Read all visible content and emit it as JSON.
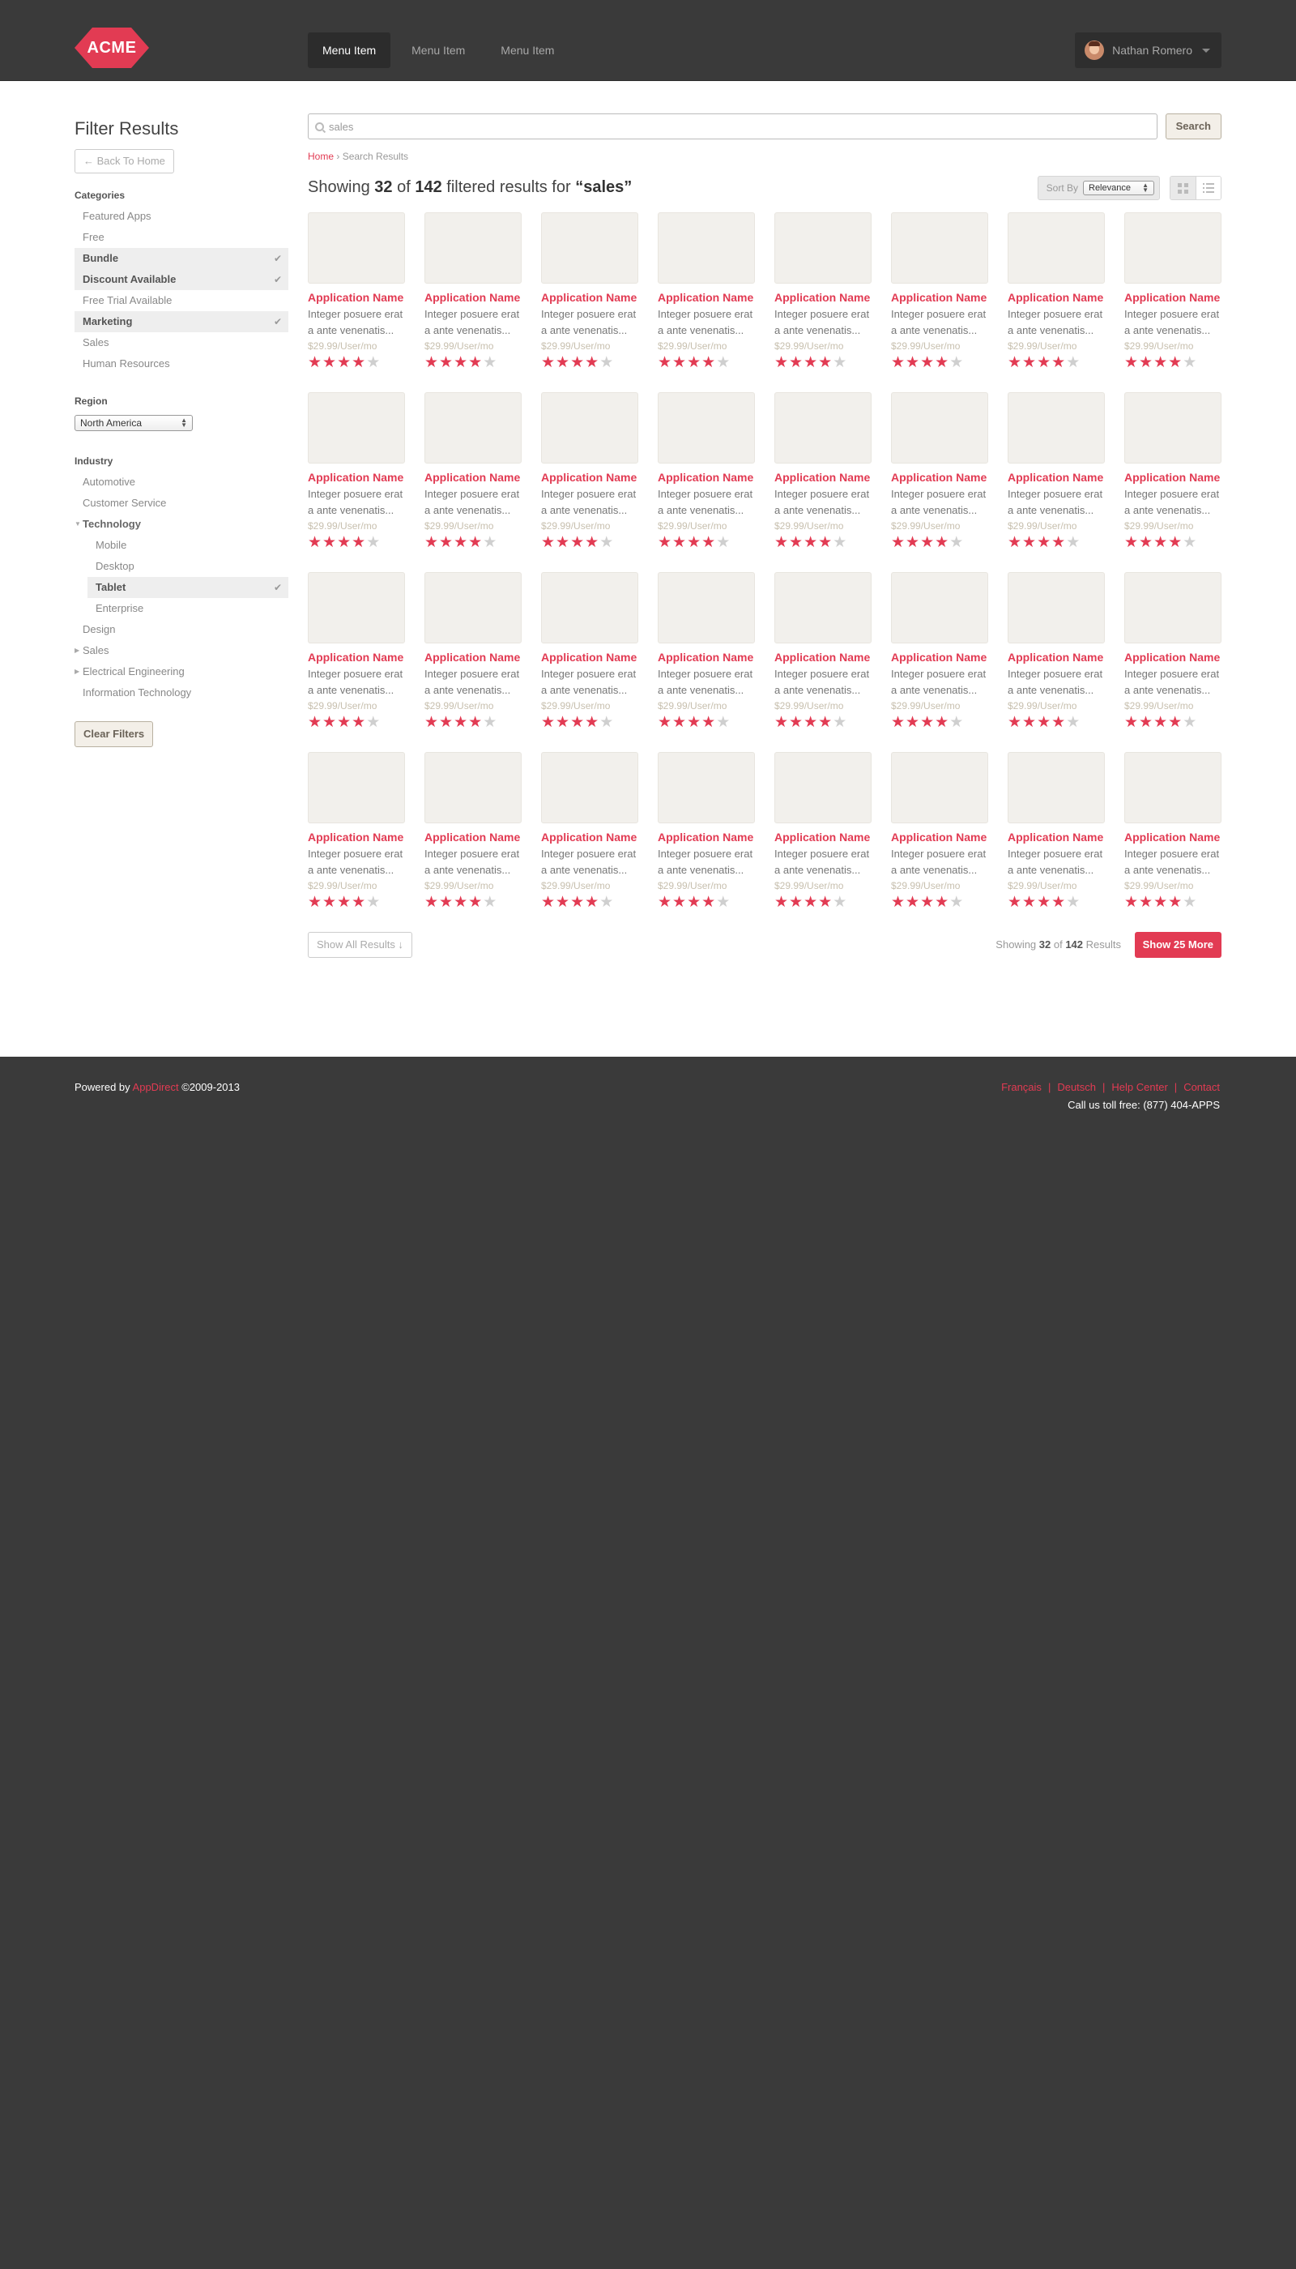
{
  "header": {
    "logo_text": "ACME",
    "nav": [
      "Menu Item",
      "Menu Item",
      "Menu Item"
    ],
    "user_name": "Nathan Romero"
  },
  "sidebar": {
    "title": "Filter Results",
    "back_label": "← Back To Home",
    "categories_title": "Categories",
    "categories": [
      {
        "label": "Featured Apps",
        "selected": false
      },
      {
        "label": "Free",
        "selected": false
      },
      {
        "label": "Bundle",
        "selected": true
      },
      {
        "label": "Discount Available",
        "selected": true
      },
      {
        "label": "Free Trial Available",
        "selected": false
      },
      {
        "label": "Marketing",
        "selected": true
      },
      {
        "label": "Sales",
        "selected": false
      },
      {
        "label": "Human Resources",
        "selected": false
      }
    ],
    "region_title": "Region",
    "region_value": "North America",
    "industry_title": "Industry",
    "industry": [
      {
        "label": "Automotive"
      },
      {
        "label": "Customer Service"
      },
      {
        "label": "Technology"
      },
      {
        "label": "Mobile"
      },
      {
        "label": "Desktop"
      },
      {
        "label": "Tablet"
      },
      {
        "label": "Enterprise"
      },
      {
        "label": "Design"
      },
      {
        "label": "Sales"
      },
      {
        "label": "Electrical Engineering"
      },
      {
        "label": "Information Technology"
      }
    ],
    "clear_label": "Clear Filters"
  },
  "search": {
    "value": "sales",
    "button_label": "Search"
  },
  "breadcrumb": {
    "home": "Home",
    "sep": " › ",
    "current": "Search Results"
  },
  "results": {
    "prefix": "Showing ",
    "shown": "32",
    "of": " of ",
    "total": "142",
    "suffix": " filtered results for ",
    "query": "“sales”",
    "sort_label": "Sort By",
    "sort_value": "Relevance"
  },
  "card": {
    "name": "Application Name",
    "desc_line1": "Integer posuere erat",
    "desc_line2": "a ante venenatis...",
    "price": "$29.99/User/mo",
    "rating": 4,
    "rating_max": 5
  },
  "card_count": 32,
  "bottom": {
    "show_all": "Show All Results ↓",
    "count_prefix": "Showing ",
    "count_shown": "32",
    "count_of": " of ",
    "count_total": "142",
    "count_suffix": " Results",
    "more_label": "Show 25 More"
  },
  "footer": {
    "powered_prefix": "Powered by ",
    "powered_link": "AppDirect",
    "powered_suffix": " ©2009-2013",
    "links": [
      "Français",
      "Deutsch",
      "Help Center",
      "Contact"
    ],
    "toll": "Call us toll free: (877) 404-APPS"
  },
  "colors": {
    "accent": "#e23b53",
    "header_bg": "#3a3a3a",
    "star_off": "#cfcfcf",
    "price": "#c7bfae"
  }
}
